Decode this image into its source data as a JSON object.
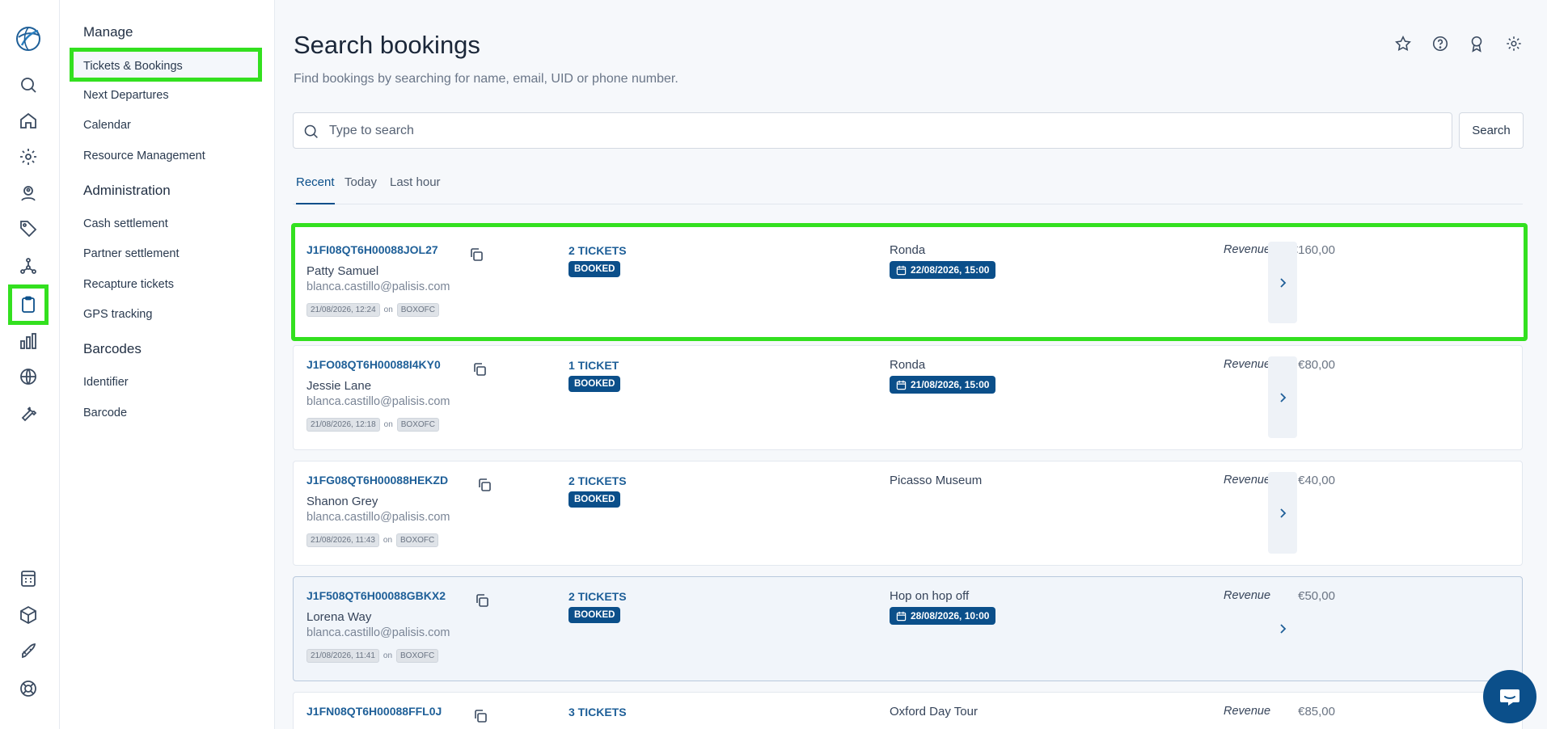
{
  "nav": {
    "sections": [
      {
        "title": "Manage",
        "items": [
          "Tickets & Bookings",
          "Next Departures",
          "Calendar",
          "Resource Management"
        ]
      },
      {
        "title": "Administration",
        "items": [
          "Cash settlement",
          "Partner settlement",
          "Recapture tickets",
          "GPS tracking"
        ]
      },
      {
        "title": "Barcodes",
        "items": [
          "Identifier",
          "Barcode"
        ]
      }
    ],
    "selected": "Tickets & Bookings"
  },
  "rail": {
    "icons": [
      "logo-icon",
      "search-icon",
      "home-icon",
      "gear-icon",
      "user-pin-icon",
      "tag-icon",
      "network-icon",
      "clipboard-icon",
      "bar-chart-icon",
      "globe-icon",
      "wrench-icon",
      "calculator-icon",
      "cube-icon",
      "rocket-icon",
      "lifebuoy-icon"
    ],
    "active": "clipboard-icon"
  },
  "page": {
    "title": "Search bookings",
    "subtitle": "Find bookings by searching for name, email, UID or phone number."
  },
  "search": {
    "placeholder": "Type to search",
    "value": "",
    "button": "Search"
  },
  "tabs": [
    "Recent",
    "Today",
    "Last hour"
  ],
  "active_tab": "Recent",
  "bookings": [
    {
      "uid": "J1FI08QT6H00088JOL27",
      "name": "Patty Samuel",
      "email": "blanca.castillo@palisis.com",
      "created": "21/08/2026, 12:24",
      "on": "on",
      "channel": "BOXOFC",
      "tickets": "2 TICKETS",
      "status": "BOOKED",
      "product": "Ronda",
      "departure": "22/08/2026, 15:00",
      "revenue_label": "Revenue",
      "revenue": "€160,00"
    },
    {
      "uid": "J1FO08QT6H00088I4KY0",
      "name": "Jessie Lane",
      "email": "blanca.castillo@palisis.com",
      "created": "21/08/2026, 12:18",
      "on": "on",
      "channel": "BOXOFC",
      "tickets": "1 TICKET",
      "status": "BOOKED",
      "product": "Ronda",
      "departure": "21/08/2026, 15:00",
      "revenue_label": "Revenue",
      "revenue": "€80,00"
    },
    {
      "uid": "J1FG08QT6H00088HEKZD",
      "name": "Shanon Grey",
      "email": "blanca.castillo@palisis.com",
      "created": "21/08/2026, 11:43",
      "on": "on",
      "channel": "BOXOFC",
      "tickets": "2 TICKETS",
      "status": "BOOKED",
      "product": "Picasso Museum",
      "departure": "",
      "revenue_label": "Revenue",
      "revenue": "€40,00"
    },
    {
      "uid": "J1F508QT6H00088GBKX2",
      "name": "Lorena Way",
      "email": "blanca.castillo@palisis.com",
      "created": "21/08/2026, 11:41",
      "on": "on",
      "channel": "BOXOFC",
      "tickets": "2 TICKETS",
      "status": "BOOKED",
      "product": "Hop on hop off",
      "departure": "28/08/2026, 10:00",
      "revenue_label": "Revenue",
      "revenue": "€50,00"
    },
    {
      "uid": "J1FN08QT6H00088FFL0J",
      "name": "",
      "email": "",
      "created": "",
      "on": "",
      "channel": "",
      "tickets": "3 TICKETS",
      "status": "",
      "product": "Oxford Day Tour",
      "departure": "",
      "revenue_label": "Revenue",
      "revenue": "€85,00"
    }
  ],
  "colors": {
    "accent": "#0b4f8a",
    "highlight": "#33e01f",
    "link": "#1e5f98"
  }
}
